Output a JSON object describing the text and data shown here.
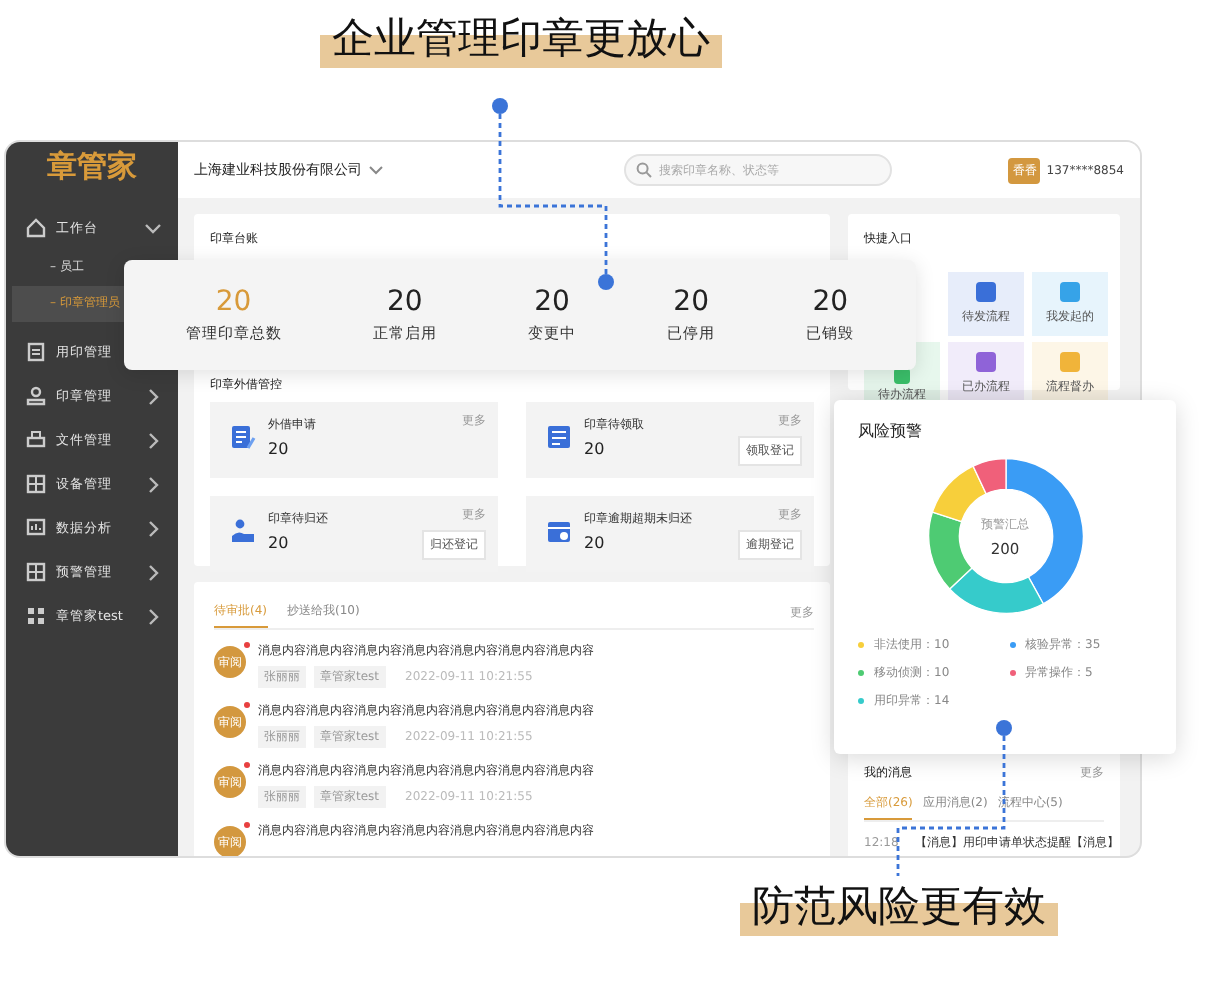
{
  "headlines": [
    {
      "kind": "top",
      "text": "企业管理印章更放心"
    },
    {
      "kind": "bottom",
      "text": "防范风险更有效"
    }
  ],
  "sidebar": {
    "logo": "章管家",
    "items": [
      {
        "label": "工作台",
        "expanded": true,
        "selected": false,
        "children": [
          {
            "label": "– 员工",
            "selected": false
          },
          {
            "label": "– 印章管理员",
            "selected": true
          }
        ]
      },
      {
        "label": "用印管理",
        "expandable": false,
        "selected": false
      },
      {
        "label": "印章管理",
        "expandable": true,
        "selected": false
      },
      {
        "label": "文件管理",
        "expandable": true,
        "selected": false
      },
      {
        "label": "设备管理",
        "expandable": true,
        "selected": false
      },
      {
        "label": "数据分析",
        "expandable": true,
        "selected": false
      },
      {
        "label": "预警管理",
        "expandable": true,
        "selected": false
      },
      {
        "label": "章管家test",
        "expandable": true,
        "selected": false
      }
    ]
  },
  "topbar": {
    "company": "上海建业科技股份有限公司",
    "search": {
      "placeholder": "搜索印章名称、状态等"
    },
    "user": {
      "avatar": "香香",
      "phone": "137****8854"
    }
  },
  "ledger": {
    "title": "印章台账"
  },
  "stats": [
    {
      "value": "20",
      "label": "管理印章总数",
      "highlight": true
    },
    {
      "value": "20",
      "label": "正常启用",
      "highlight": false
    },
    {
      "value": "20",
      "label": "变更中",
      "highlight": false
    },
    {
      "value": "20",
      "label": "已停用",
      "highlight": false
    },
    {
      "value": "20",
      "label": "已销毁",
      "highlight": false
    }
  ],
  "lending": {
    "title": "印章外借管控",
    "cards": [
      {
        "title": "外借申请",
        "value": "20",
        "more": "更多"
      },
      {
        "title": "印章待领取",
        "value": "20",
        "more": "更多",
        "button": "领取登记"
      },
      {
        "title": "印章待归还",
        "value": "20",
        "more": "更多",
        "button": "归还登记"
      },
      {
        "title": "印章逾期超期未归还",
        "value": "20",
        "more": "更多",
        "button": "逾期登记"
      }
    ]
  },
  "tasks": {
    "tabs": [
      {
        "label": "待审批(4)",
        "selected": true
      },
      {
        "label": "抄送给我(10)",
        "selected": false
      }
    ],
    "more": "更多",
    "items": [
      {
        "avatar": "审阅",
        "unread": true,
        "title": "消息内容消息内容消息内容消息内容消息内容消息内容消息内容",
        "tags": [
          "张丽丽",
          "章管家test"
        ],
        "time": "2022-09-11 10:21:55"
      },
      {
        "avatar": "审阅",
        "unread": true,
        "title": "消息内容消息内容消息内容消息内容消息内容消息内容消息内容",
        "tags": [
          "张丽丽",
          "章管家test"
        ],
        "time": "2022-09-11 10:21:55"
      },
      {
        "avatar": "审阅",
        "unread": true,
        "title": "消息内容消息内容消息内容消息内容消息内容消息内容消息内容",
        "tags": [
          "张丽丽",
          "章管家test"
        ],
        "time": "2022-09-11 10:21:55"
      },
      {
        "avatar": "审阅",
        "unread": true,
        "title": "消息内容消息内容消息内容消息内容消息内容消息内容消息内容"
      }
    ]
  },
  "quick": {
    "title": "快捷入口",
    "items": [
      {
        "label": "待发流程",
        "color": "#3a6fd8"
      },
      {
        "label": "我发起的",
        "color": "#36a3e8"
      },
      {
        "label": "待办流程",
        "color": "#3bbf6a"
      },
      {
        "label": "已办流程",
        "color": "#8f63d8"
      },
      {
        "label": "流程督办",
        "color": "#f0b43a"
      }
    ]
  },
  "risk": {
    "title": "风险预警",
    "center_label": "预警汇总",
    "center_value": "200",
    "legend": [
      {
        "text": "非法使用：10",
        "color": "#f7cf3b"
      },
      {
        "text": "核验异常：35",
        "color": "#3a9cf5"
      },
      {
        "text": "移动侦测：10",
        "color": "#4ecb73"
      },
      {
        "text": "异常操作：5",
        "color": "#f0607a"
      },
      {
        "text": "用印异常：14",
        "color": "#36cbcb"
      }
    ]
  },
  "messages": {
    "title": "我的消息",
    "more": "更多",
    "tabs": [
      {
        "label": "全部(26)",
        "selected": true
      },
      {
        "label": "应用消息(2)",
        "selected": false
      },
      {
        "label": "流程中心(5)",
        "selected": false
      }
    ],
    "items": [
      {
        "time": "12:18",
        "text": "【消息】用印申请单状态提醒【消息】"
      }
    ]
  }
}
